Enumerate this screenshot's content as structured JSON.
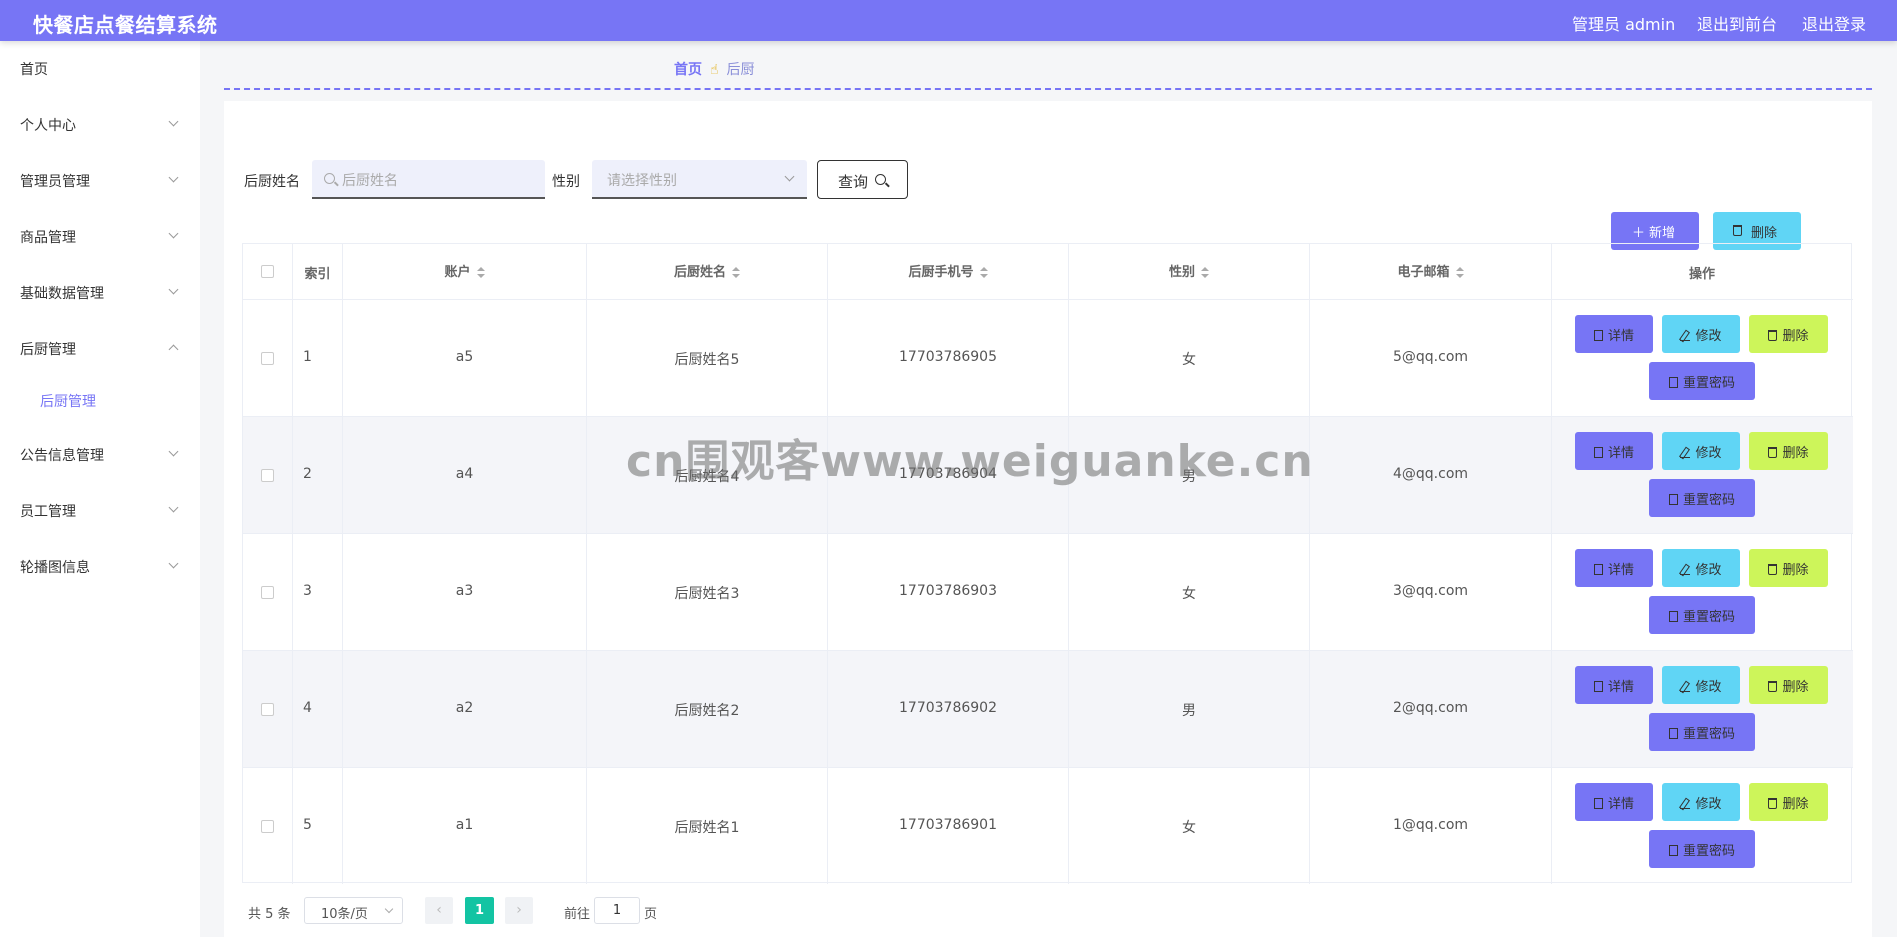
{
  "header": {
    "title": "快餐店点餐结算系统",
    "user": "管理员 admin",
    "front": "退出到前台",
    "logout": "退出登录"
  },
  "sidebar": {
    "items": [
      {
        "label": "首页"
      },
      {
        "label": "个人中心"
      },
      {
        "label": "管理员管理"
      },
      {
        "label": "商品管理"
      },
      {
        "label": "基础数据管理"
      },
      {
        "label": "后厨管理"
      },
      {
        "label": "后厨管理"
      },
      {
        "label": "公告信息管理"
      },
      {
        "label": "员工管理"
      },
      {
        "label": "轮播图信息"
      }
    ]
  },
  "breadcrumb": {
    "home": "首页",
    "current": "后厨"
  },
  "search": {
    "name_label": "后厨姓名",
    "name_placeholder": "后厨姓名",
    "gender_label": "性别",
    "gender_placeholder": "请选择性别",
    "query_label": "查询"
  },
  "toolbar": {
    "add_label": "新增",
    "delete_label": "删除"
  },
  "table": {
    "headers": [
      "索引",
      "账户",
      "后厨姓名",
      "后厨手机号",
      "性别",
      "电子邮箱",
      "操作"
    ],
    "rows": [
      {
        "index": "1",
        "account": "a5",
        "name": "后厨姓名5",
        "phone": "17703786905",
        "gender": "女",
        "email": "5@qq.com"
      },
      {
        "index": "2",
        "account": "a4",
        "name": "后厨姓名4",
        "phone": "17703786904",
        "gender": "男",
        "email": "4@qq.com"
      },
      {
        "index": "3",
        "account": "a3",
        "name": "后厨姓名3",
        "phone": "17703786903",
        "gender": "女",
        "email": "3@qq.com"
      },
      {
        "index": "4",
        "account": "a2",
        "name": "后厨姓名2",
        "phone": "17703786902",
        "gender": "男",
        "email": "2@qq.com"
      },
      {
        "index": "5",
        "account": "a1",
        "name": "后厨姓名1",
        "phone": "17703786901",
        "gender": "女",
        "email": "1@qq.com"
      }
    ],
    "actions": {
      "detail": "详情",
      "edit": "修改",
      "delete": "删除",
      "reset": "重置密码"
    }
  },
  "pagination": {
    "total": "共 5 条",
    "page_size": "10条/页",
    "prev": "‹",
    "current": "1",
    "next": "›",
    "goto": "前往",
    "goto_value": "1",
    "page_unit": "页"
  },
  "watermark": "cn围观客www.weiguanke.cn",
  "colors": {
    "accent": "#7775f5",
    "edit": "#60d5f5",
    "delete": "#cdf55a",
    "page_active": "#13c4a3"
  }
}
